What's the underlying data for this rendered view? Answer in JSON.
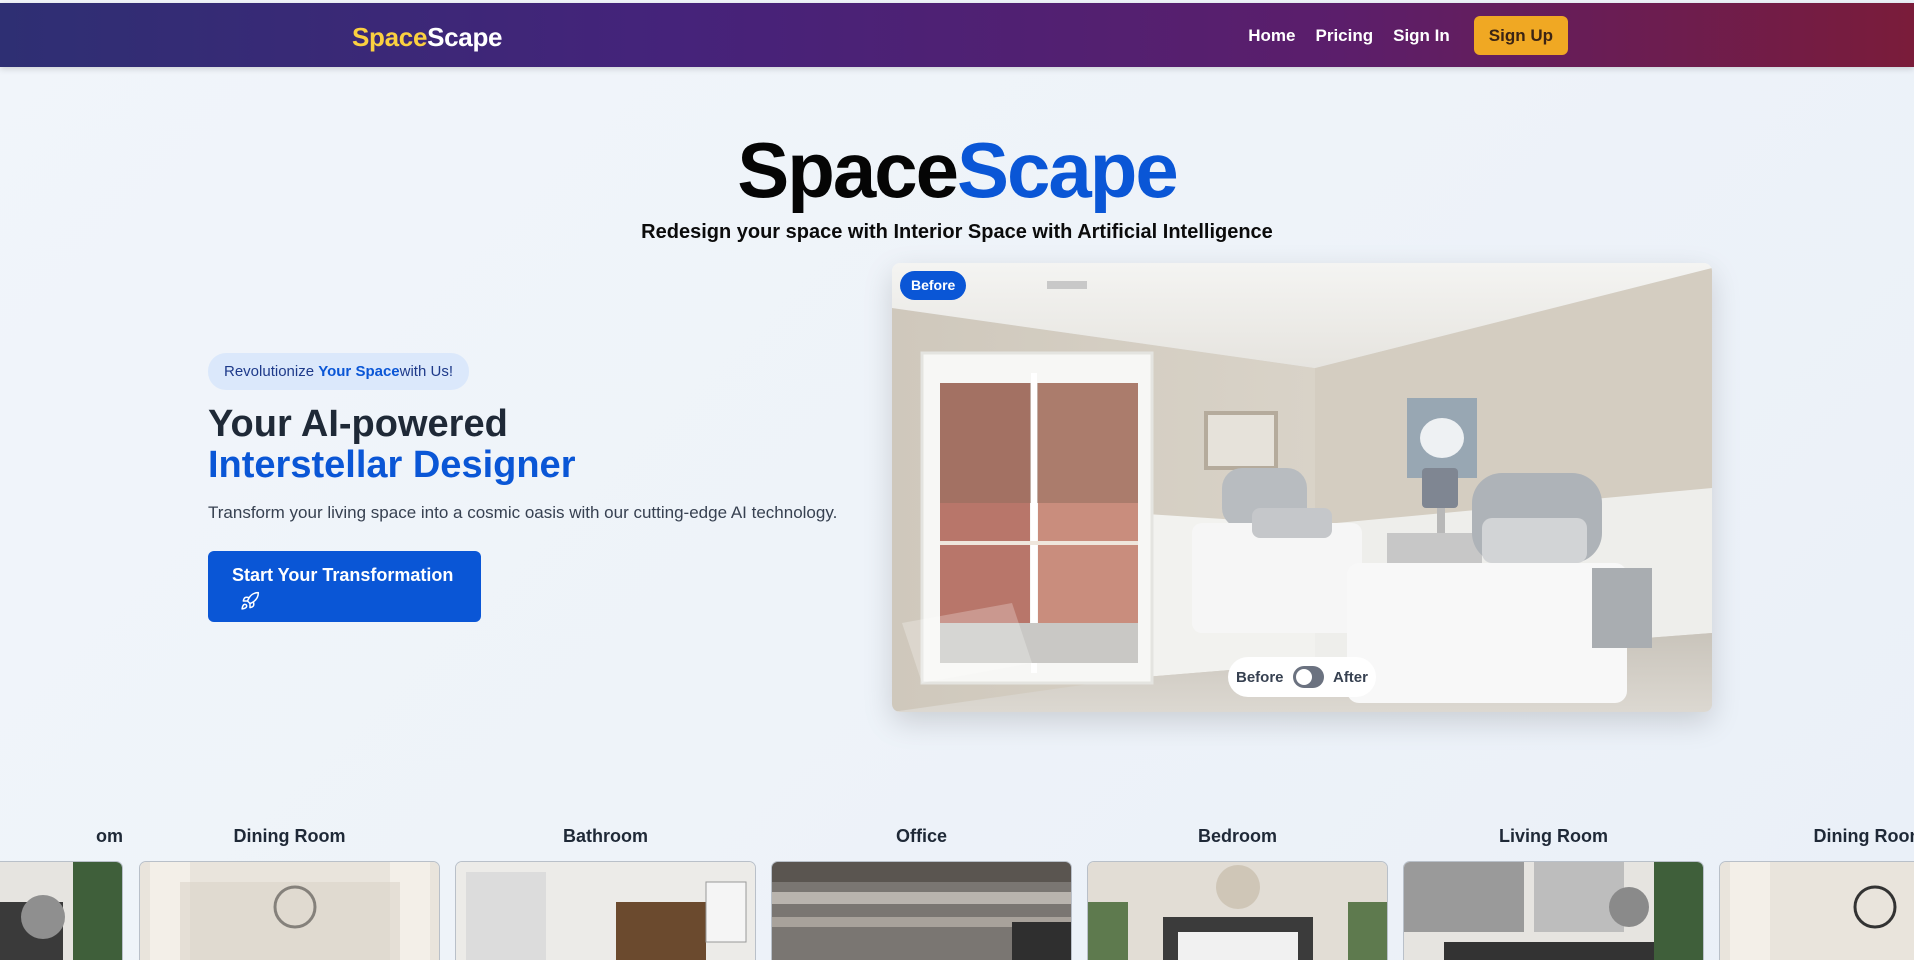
{
  "nav": {
    "logo_part1": "Space",
    "logo_part2": "Scape",
    "links": [
      "Home",
      "Pricing",
      "Sign In"
    ],
    "signup": "Sign Up"
  },
  "hero": {
    "title_part1": "Space",
    "title_part2": "Scape",
    "subtitle": "Redesign your space with Interior Space with Artificial Intelligence"
  },
  "intro": {
    "pill_pre": "Revolutionize ",
    "pill_highlight": "Your Space",
    "pill_post": "with Us!",
    "headline_line1": "Your AI-powered",
    "headline_line2": "Interstellar Designer",
    "description": "Transform your living space into a cosmic oasis with our cutting-edge AI technology.",
    "cta_label": "Start Your Transformation",
    "cta_icon": "rocket-icon"
  },
  "preview": {
    "badge": "Before",
    "toggle_left": "Before",
    "toggle_right": "After",
    "toggle_on": false
  },
  "rooms": [
    "om",
    "Dining Room",
    "Bathroom",
    "Office",
    "Bedroom",
    "Living Room",
    "Dining Room"
  ],
  "colors": {
    "brand_blue": "#0a56d6",
    "accent_yellow": "#fbd040",
    "signup_orange": "#f0a823"
  }
}
